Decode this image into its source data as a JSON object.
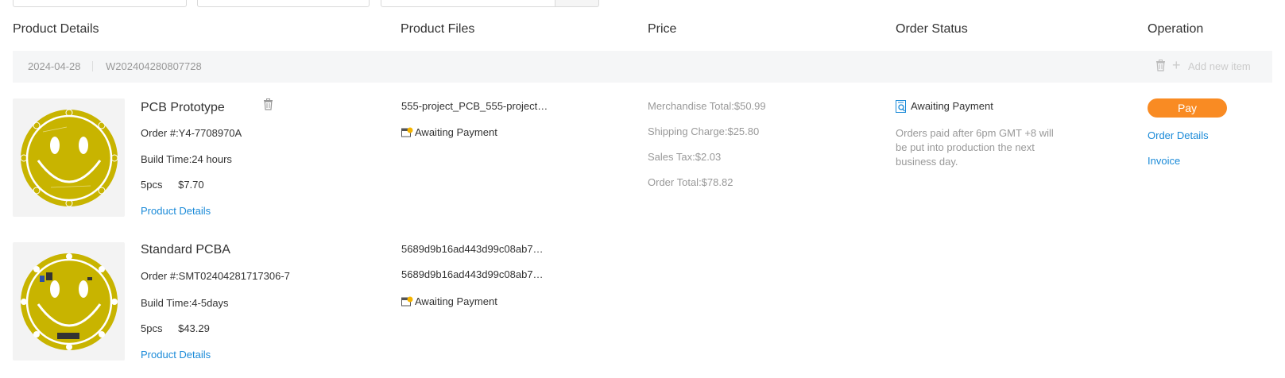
{
  "table": {
    "headers": {
      "product_details": "Product Details",
      "product_files": "Product Files",
      "price": "Price",
      "order_status": "Order Status",
      "operation": "Operation"
    }
  },
  "group": {
    "date": "2024-04-28",
    "order_no": "W202404280807728",
    "add_item_label": "Add new item"
  },
  "products": [
    {
      "name": "PCB Prototype",
      "order_no": "Order #:Y4-7708970A",
      "build_time": "Build Time:24 hours",
      "qty": "5pcs",
      "price": "$7.70",
      "details_link": "Product Details",
      "files": [
        "555-project_PCB_555-project…"
      ],
      "file_status": "Awaiting Payment"
    },
    {
      "name": "Standard PCBA",
      "order_no": "Order #:SMT02404281717306-7",
      "build_time": "Build Time:4-5days",
      "qty": "5pcs",
      "price": "$43.29",
      "details_link": "Product Details",
      "files": [
        "5689d9b16ad443d99c08ab7…",
        "5689d9b16ad443d99c08ab7…"
      ],
      "file_status": "Awaiting Payment"
    }
  ],
  "price": {
    "merchandise": "Merchandise Total:$50.99",
    "shipping": "Shipping Charge:$25.80",
    "tax": "Sales Tax:$2.03",
    "total": "Order Total:$78.82"
  },
  "order_status": {
    "title": "Awaiting Payment",
    "note": "Orders paid after 6pm GMT +8 will be put into production the next business day."
  },
  "operation": {
    "pay_label": "Pay",
    "order_details_label": "Order Details",
    "invoice_label": "Invoice"
  },
  "colors": {
    "accent_link": "#1a8ad8",
    "pay_button": "#f98b23",
    "pcb_gold": "#c8b400"
  },
  "icons": {
    "trash": "trash-icon",
    "plus": "plus-icon",
    "status": "awaiting-payment-icon",
    "order_status": "document-search-icon"
  }
}
